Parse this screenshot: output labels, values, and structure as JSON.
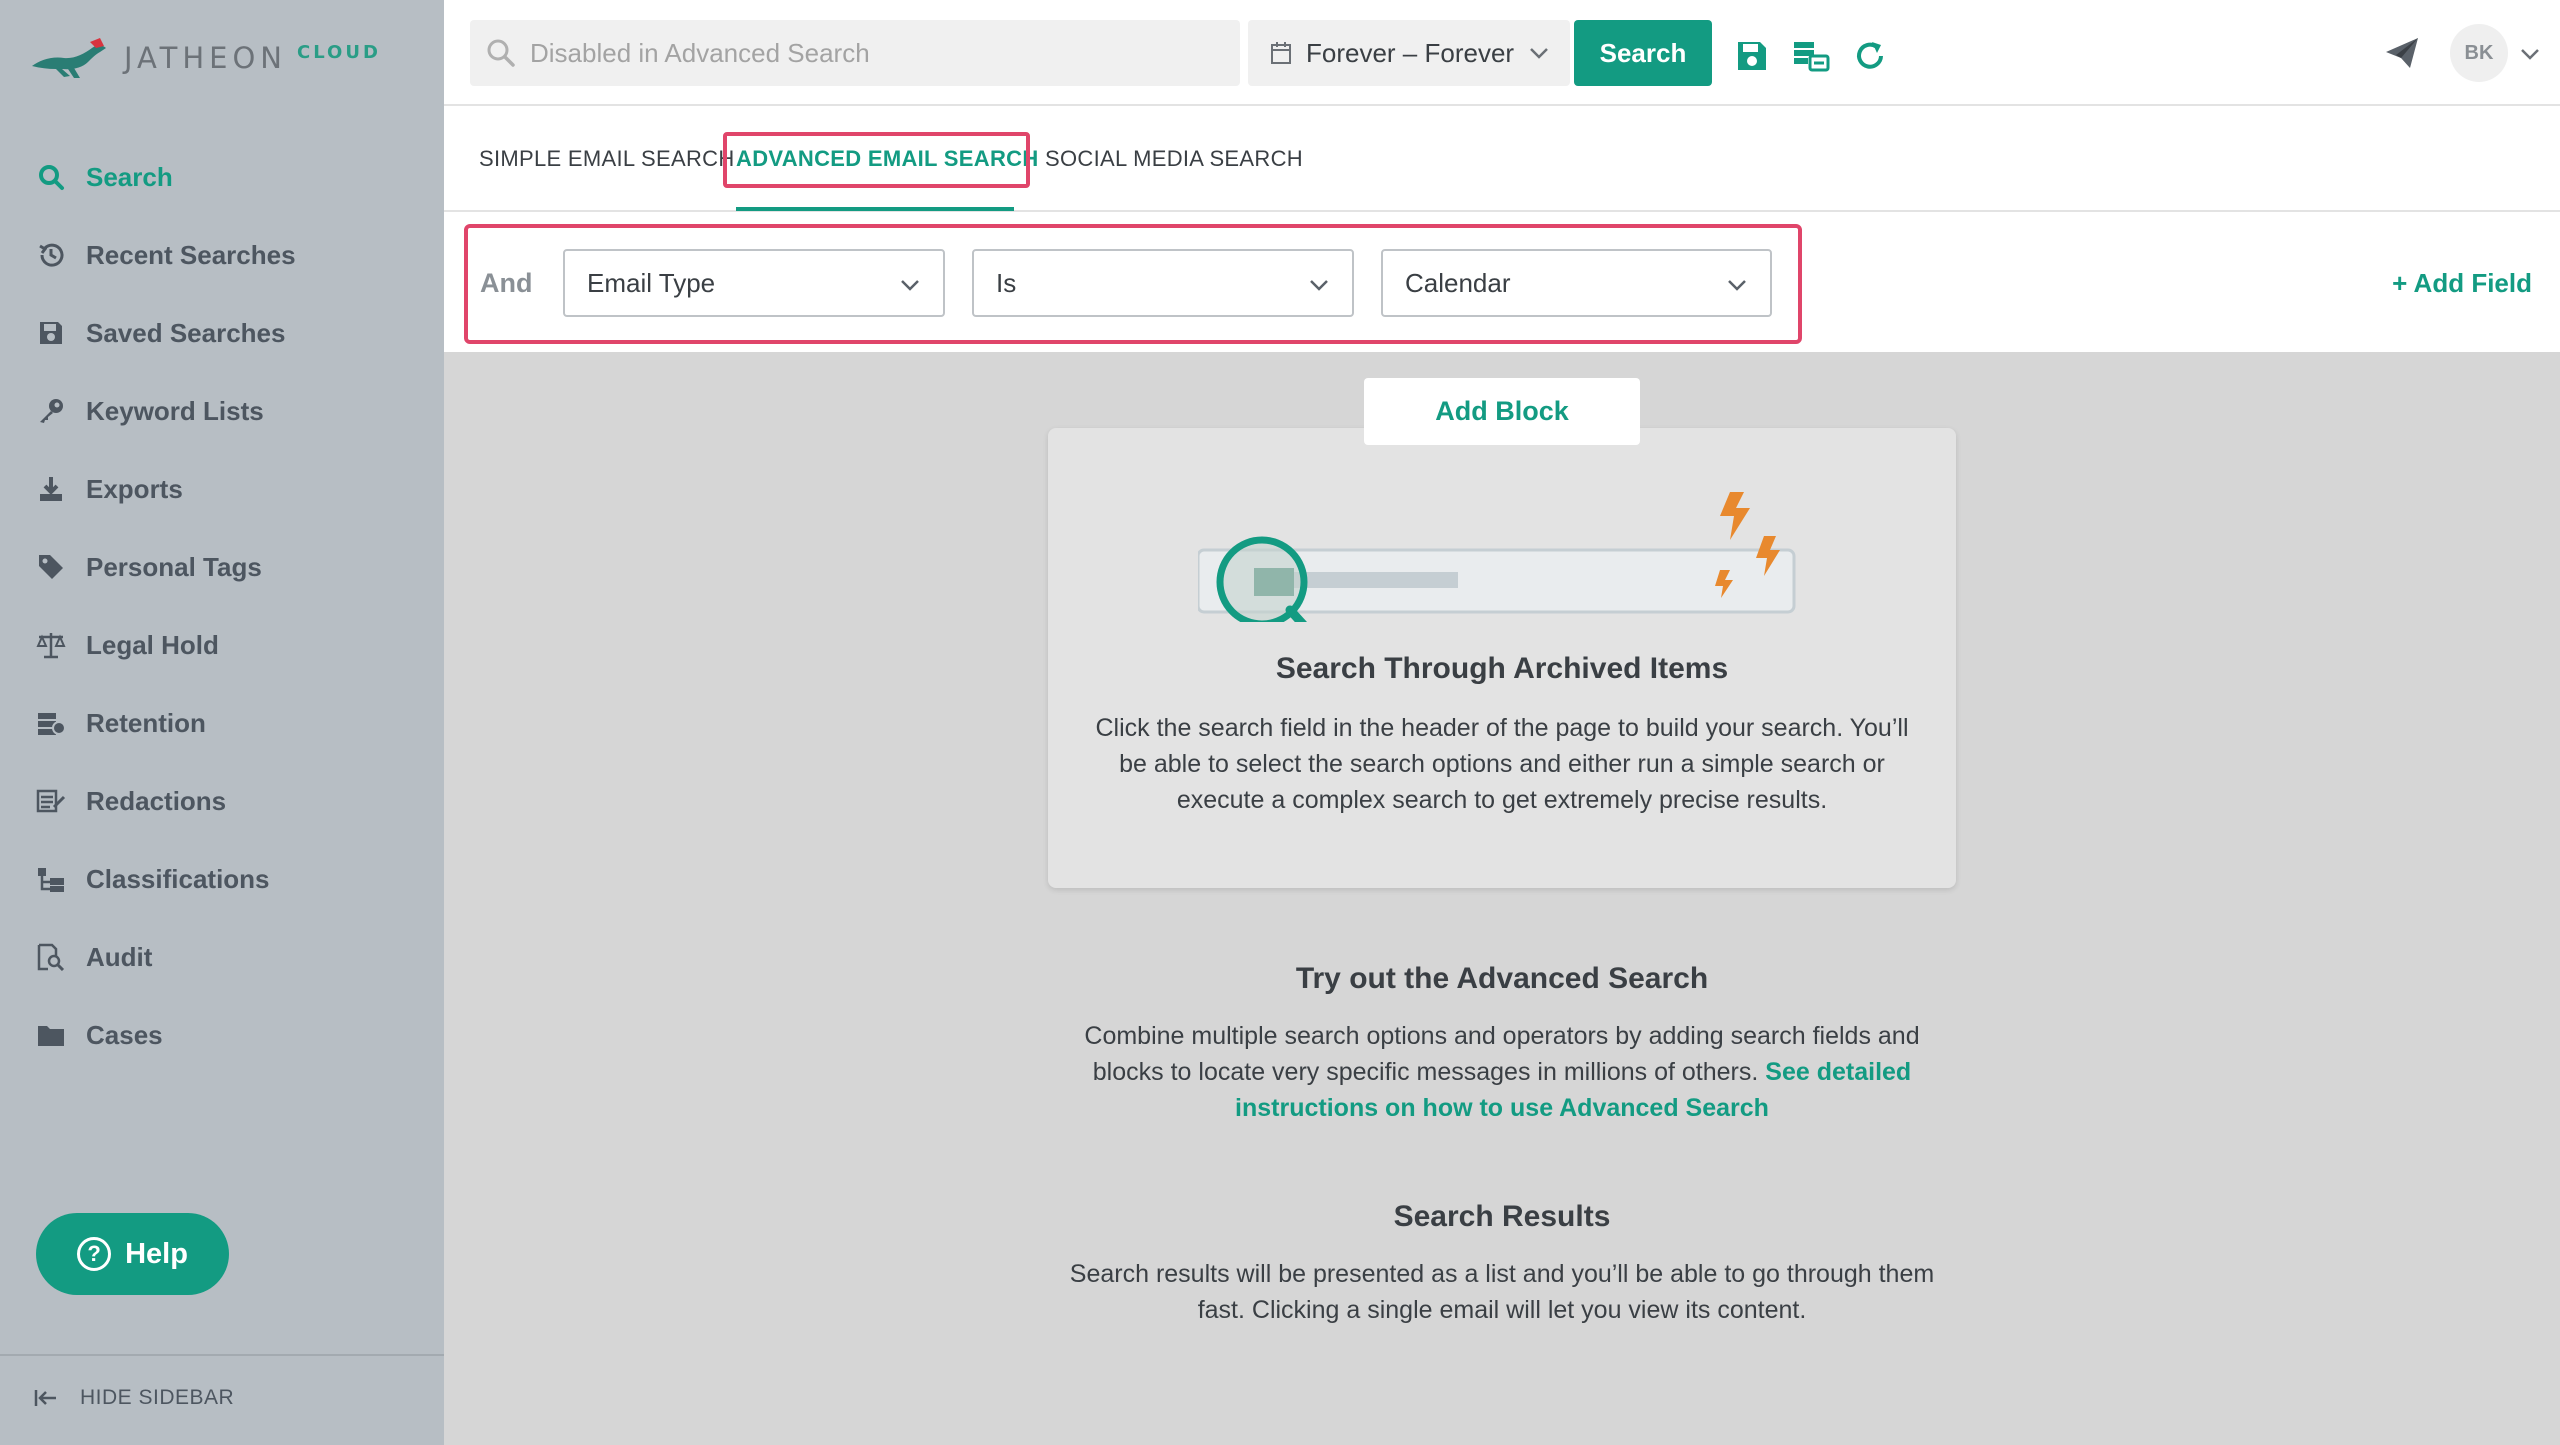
{
  "brand": {
    "name": "JATHEON",
    "suffix": "CLOUD"
  },
  "sidebar": {
    "items": [
      {
        "label": "Search",
        "icon": "search-icon",
        "active": true
      },
      {
        "label": "Recent Searches",
        "icon": "history-icon"
      },
      {
        "label": "Saved Searches",
        "icon": "floppy-disk-icon"
      },
      {
        "label": "Keyword Lists",
        "icon": "key-icon"
      },
      {
        "label": "Exports",
        "icon": "download-icon"
      },
      {
        "label": "Personal Tags",
        "icon": "tag-icon"
      },
      {
        "label": "Legal Hold",
        "icon": "scales-icon"
      },
      {
        "label": "Retention",
        "icon": "retention-icon"
      },
      {
        "label": "Redactions",
        "icon": "redaction-icon"
      },
      {
        "label": "Classifications",
        "icon": "classification-icon"
      },
      {
        "label": "Audit",
        "icon": "audit-icon"
      },
      {
        "label": "Cases",
        "icon": "folder-icon"
      }
    ],
    "help_label": "Help",
    "hide_label": "HIDE SIDEBAR"
  },
  "topbar": {
    "search_placeholder": "Disabled in Advanced Search",
    "date_range": "Forever – Forever",
    "search_button": "Search",
    "avatar_initials": "BK"
  },
  "tabs": [
    {
      "label": "SIMPLE EMAIL SEARCH"
    },
    {
      "label": "ADVANCED EMAIL SEARCH",
      "active": true
    },
    {
      "label": "SOCIAL MEDIA SEARCH"
    }
  ],
  "filter": {
    "operator": "And",
    "field": "Email Type",
    "condition": "Is",
    "value": "Calendar",
    "add_field": "+ Add Field"
  },
  "main": {
    "add_block": "Add Block",
    "card": {
      "title": "Search Through Archived Items",
      "text": "Click the search field in the header of the page to build your search. You’ll be able to select the search options and either run a simple search or execute a complex search to get extremely precise results."
    },
    "advanced": {
      "title": "Try out the Advanced Search",
      "text": "Combine multiple search options and operators by adding search fields and blocks to locate very specific messages in millions of others.",
      "link": "See detailed instructions on how to use Advanced Search"
    },
    "results": {
      "title": "Search Results",
      "text": "Search results will be presented as a list and you’ll be able to go through them fast. Clicking a single email will let you view its content."
    }
  },
  "colors": {
    "accent": "#139b82",
    "sidebar_bg": "#b7bec4",
    "highlight": "#e0456a",
    "bolt": "#e8892e"
  }
}
